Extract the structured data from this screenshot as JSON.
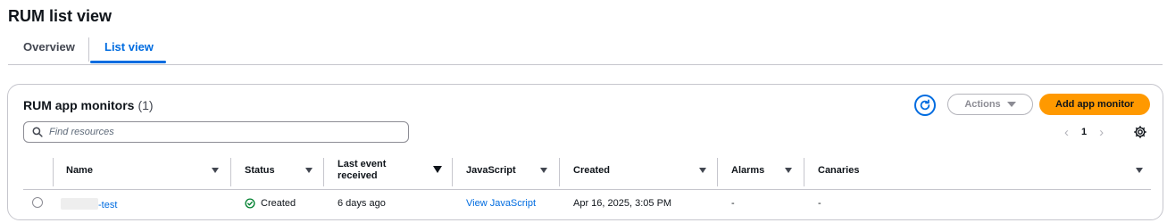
{
  "page": {
    "title": "RUM list view"
  },
  "tabs": [
    {
      "label": "Overview"
    },
    {
      "label": "List view",
      "active": true
    }
  ],
  "panel": {
    "title": "RUM app monitors",
    "count": "(1)",
    "actions_label": "Actions",
    "add_label": "Add app monitor",
    "search_placeholder": "Find resources",
    "page_number": "1"
  },
  "table": {
    "columns": [
      "Name",
      "Status",
      "Last event received",
      "JavaScript",
      "Created",
      "Alarms",
      "Canaries"
    ],
    "rows": [
      {
        "name_suffix": "-test",
        "status": "Created",
        "last_event": "6 days ago",
        "javascript": "View JavaScript",
        "created": "Apr 16, 2025, 3:05 PM",
        "alarms": "-",
        "canaries": "-"
      }
    ]
  },
  "colors": {
    "accent": "#006ce0",
    "primary_button": "#ff9900",
    "success": "#00802f"
  },
  "icons": [
    "search-icon",
    "refresh-icon",
    "caret-down-icon",
    "chevron-left-icon",
    "chevron-right-icon",
    "settings-icon",
    "status-success-icon",
    "sort-caret-icon"
  ]
}
